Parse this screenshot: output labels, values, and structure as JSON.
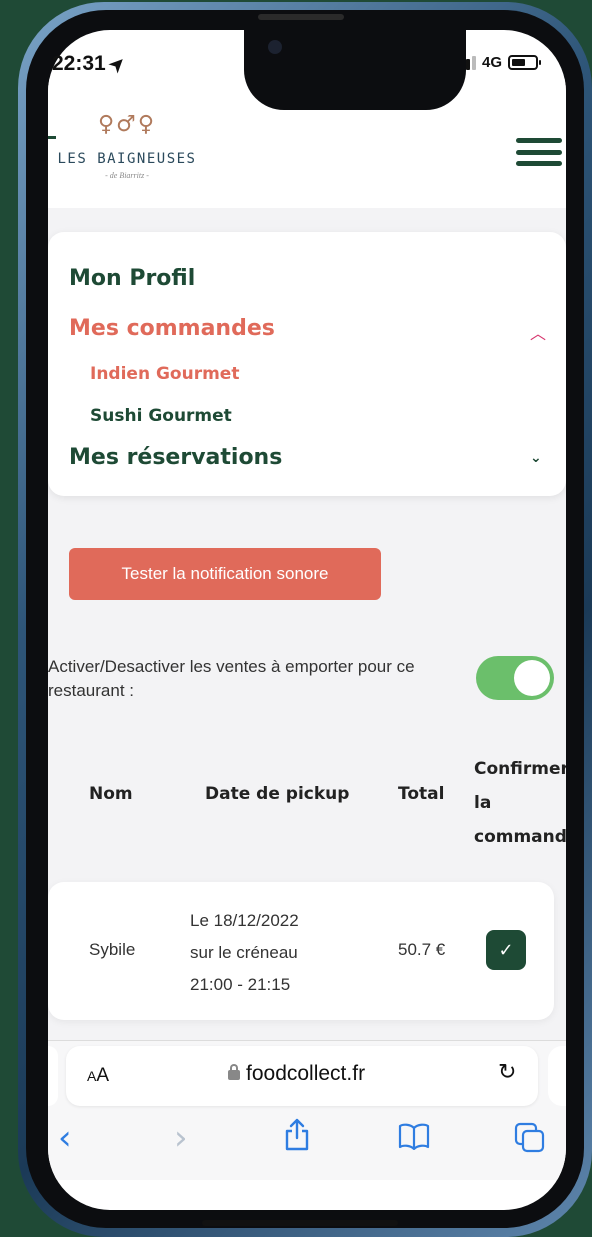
{
  "status_bar": {
    "time": "22:31",
    "network": "4G"
  },
  "header": {
    "logo_name": "LES BAIGNEUSES",
    "logo_sub": "- de Biarritz -"
  },
  "menu": {
    "mon_profil": "Mon Profil",
    "mes_commandes": "Mes commandes",
    "sub_items": [
      "Indien Gourmet",
      "Sushi Gourmet"
    ],
    "mes_reservations": "Mes réservations"
  },
  "notification_button": "Tester la notification sonore",
  "toggle": {
    "label": "Activer/Desactiver les ventes à emporter pour ce restaurant :",
    "state": "on"
  },
  "table": {
    "headers": {
      "nom": "Nom",
      "date": "Date de pickup",
      "total": "Total",
      "confirm_line1": "Confirmer",
      "confirm_line2": "la",
      "confirm_line3": "commande"
    },
    "rows": [
      {
        "nom": "Sybile",
        "date_line1": "Le 18/12/2022",
        "date_line2": "sur le créneau",
        "date_line3": "21:00 - 21:15",
        "total": "50.7 €",
        "confirmed": true
      }
    ]
  },
  "browser": {
    "text_size": "AA",
    "url": "foodcollect.fr"
  },
  "colors": {
    "brand_green": "#1e4a35",
    "accent_coral": "#e06a5a",
    "toggle_on": "#6bbf6b",
    "ios_blue": "#2f7de1"
  }
}
